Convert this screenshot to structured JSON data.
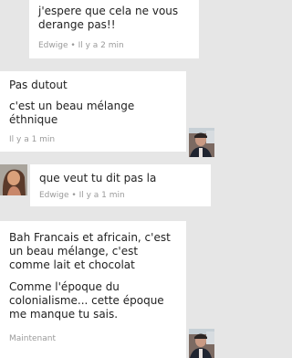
{
  "messages": [
    {
      "lines": [
        "j'espere que cela ne vous derange pas!!"
      ],
      "author": "Edwige",
      "time": "Il y a 2 min",
      "avatar": "woman-portrait"
    },
    {
      "lines": [
        "Pas dutout",
        "c'est un beau mélange éthnique"
      ],
      "time": "Il y a 1 min",
      "avatar": "man-portrait"
    },
    {
      "lines": [
        "que veut tu dit pas la"
      ],
      "author": "Edwige",
      "time": "Il y a 1 min",
      "avatar": "woman-portrait"
    },
    {
      "lines": [
        "Bah Francais et africain, c'est un beau mélange, c'est comme lait et chocolat",
        "Comme l'époque du colonialisme... cette époque me manque tu sais."
      ],
      "time": "Maintenant",
      "avatar": "man-portrait"
    }
  ]
}
